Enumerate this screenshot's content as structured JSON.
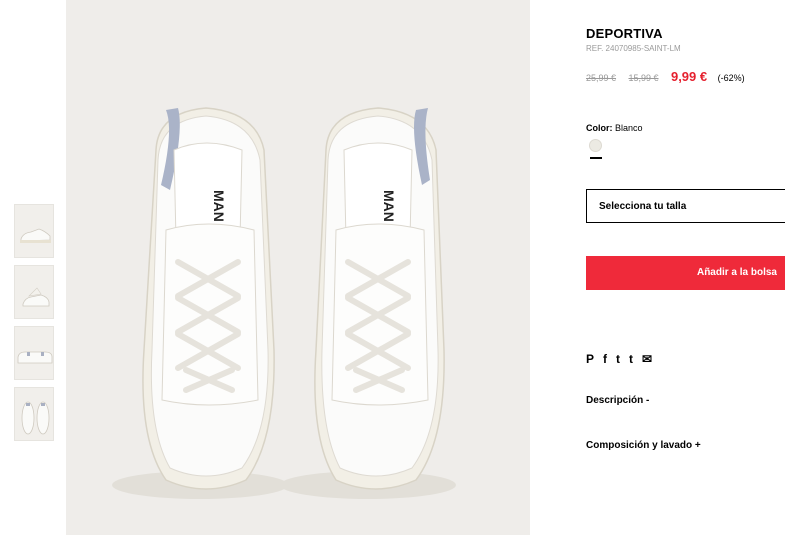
{
  "product": {
    "title": "DEPORTIVA",
    "ref": "REF. 24070985-SAINT-LM",
    "price_original": "25,99 €",
    "price_previous": "15,99 €",
    "price_sale": "9,99 €",
    "discount": "(-62%)"
  },
  "color": {
    "label": "Color:",
    "value": "Blanco",
    "swatch_hex": "#eceae3"
  },
  "size_select": {
    "label": "Selecciona tu talla"
  },
  "add_to_bag": {
    "label": "Añadir a la bolsa",
    "color": "#ef2a3a"
  },
  "social": {
    "pinterest": "P",
    "facebook": "f",
    "twitter": "t",
    "tumblr": "t",
    "email": "✉"
  },
  "sections": [
    {
      "label": "Descripción -"
    },
    {
      "label": "Composición y lavado +"
    }
  ],
  "thumbnails": [
    {
      "icon": "sneaker-side-view"
    },
    {
      "icon": "sneaker-angle-view"
    },
    {
      "icon": "sneaker-back-view"
    },
    {
      "icon": "sneaker-top-view"
    }
  ],
  "main_image": {
    "icon": "white-sneakers-top-view",
    "brand_print": "MAN"
  }
}
